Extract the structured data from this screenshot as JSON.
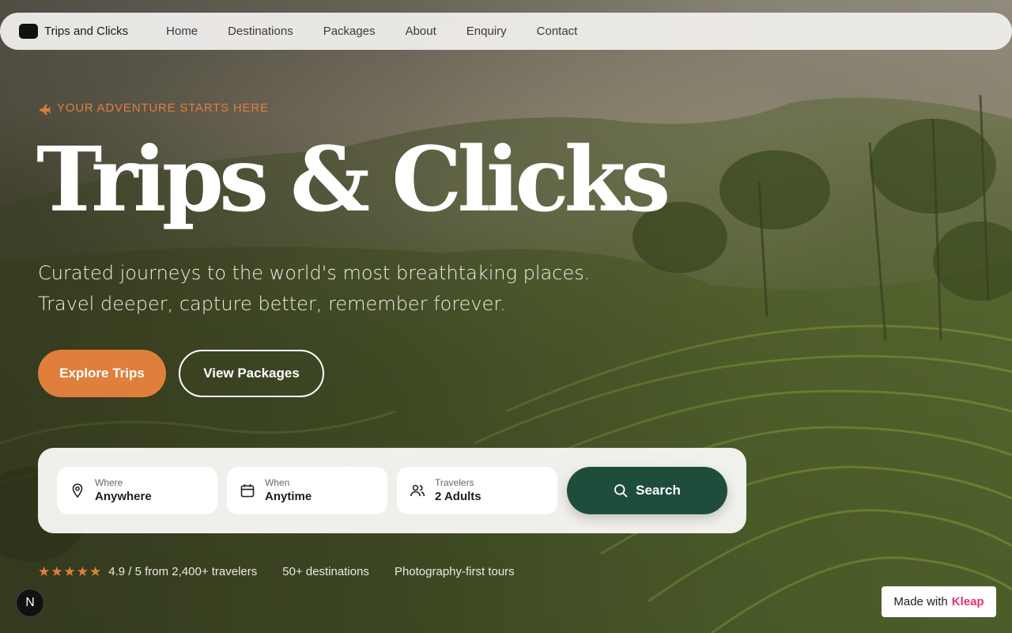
{
  "nav": {
    "brand": "Trips and Clicks",
    "links": [
      "Home",
      "Destinations",
      "Packages",
      "About",
      "Enquiry",
      "Contact"
    ]
  },
  "hero": {
    "eyebrow": "YOUR ADVENTURE STARTS HERE",
    "title": "Trips & Clicks",
    "subtitle_line1": "Curated journeys to the world's most breathtaking places.",
    "subtitle_line2": "Travel deeper, capture better, remember forever.",
    "primary_cta": "Explore Trips",
    "secondary_cta": "View Packages"
  },
  "search": {
    "where": {
      "label": "Where",
      "value": "Anywhere",
      "icon": "map-pin-icon"
    },
    "when": {
      "label": "When",
      "value": "Anytime",
      "icon": "calendar-icon"
    },
    "travelers": {
      "label": "Travelers",
      "value": "2 Adults",
      "icon": "users-icon"
    },
    "button": "Search"
  },
  "stats": {
    "rating_stars": 5,
    "rating_text": "4.9 / 5 from 2,400+ travelers",
    "destinations": "50+ destinations",
    "tours": "Photography-first tours"
  },
  "badges": {
    "n_letter": "N",
    "made_with_prefix": "Made with",
    "made_with_brand": "Kleap"
  },
  "colors": {
    "accent": "#e07f3c",
    "search_button": "#1f4d3c",
    "brand_pink": "#e8336b"
  }
}
